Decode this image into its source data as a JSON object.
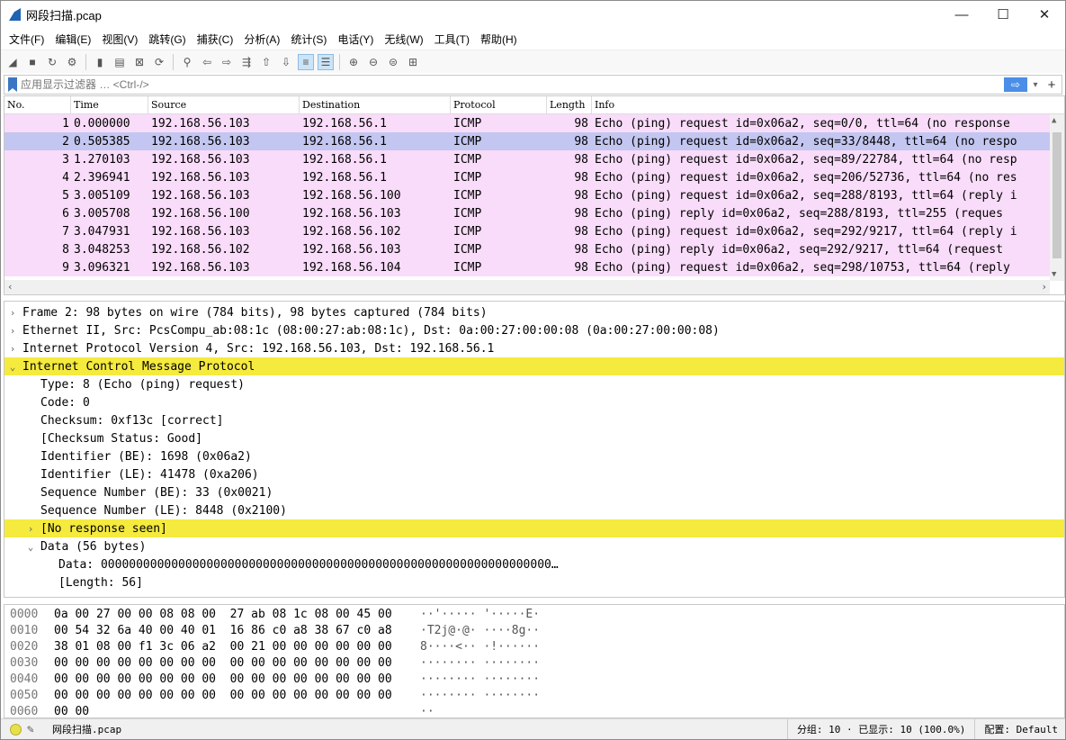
{
  "window": {
    "title": "网段扫描.pcap",
    "minimize": "—",
    "maximize": "☐",
    "close": "✕"
  },
  "menu": [
    "文件(F)",
    "编辑(E)",
    "视图(V)",
    "跳转(G)",
    "捕获(C)",
    "分析(A)",
    "统计(S)",
    "电话(Y)",
    "无线(W)",
    "工具(T)",
    "帮助(H)"
  ],
  "filter": {
    "placeholder": "应用显示过滤器 … <Ctrl-/>",
    "apply": "⇨",
    "dropdown": "▾",
    "add": "+"
  },
  "packet_list": {
    "columns": [
      "No.",
      "Time",
      "Source",
      "Destination",
      "Protocol",
      "Length",
      "Info"
    ],
    "rows": [
      {
        "no": "1",
        "time": "0.000000",
        "src": "192.168.56.103",
        "dst": "192.168.56.1",
        "proto": "ICMP",
        "len": "98",
        "info": "Echo (ping) request  id=0x06a2, seq=0/0, ttl=64 (no response"
      },
      {
        "no": "2",
        "time": "0.505385",
        "src": "192.168.56.103",
        "dst": "192.168.56.1",
        "proto": "ICMP",
        "len": "98",
        "info": "Echo (ping) request  id=0x06a2, seq=33/8448, ttl=64 (no respo"
      },
      {
        "no": "3",
        "time": "1.270103",
        "src": "192.168.56.103",
        "dst": "192.168.56.1",
        "proto": "ICMP",
        "len": "98",
        "info": "Echo (ping) request  id=0x06a2, seq=89/22784, ttl=64 (no resp"
      },
      {
        "no": "4",
        "time": "2.396941",
        "src": "192.168.56.103",
        "dst": "192.168.56.1",
        "proto": "ICMP",
        "len": "98",
        "info": "Echo (ping) request  id=0x06a2, seq=206/52736, ttl=64 (no res"
      },
      {
        "no": "5",
        "time": "3.005109",
        "src": "192.168.56.103",
        "dst": "192.168.56.100",
        "proto": "ICMP",
        "len": "98",
        "info": "Echo (ping) request  id=0x06a2, seq=288/8193, ttl=64 (reply i"
      },
      {
        "no": "6",
        "time": "3.005708",
        "src": "192.168.56.100",
        "dst": "192.168.56.103",
        "proto": "ICMP",
        "len": "98",
        "info": "Echo (ping) reply    id=0x06a2, seq=288/8193, ttl=255 (reques"
      },
      {
        "no": "7",
        "time": "3.047931",
        "src": "192.168.56.103",
        "dst": "192.168.56.102",
        "proto": "ICMP",
        "len": "98",
        "info": "Echo (ping) request  id=0x06a2, seq=292/9217, ttl=64 (reply i"
      },
      {
        "no": "8",
        "time": "3.048253",
        "src": "192.168.56.102",
        "dst": "192.168.56.103",
        "proto": "ICMP",
        "len": "98",
        "info": "Echo (ping) reply    id=0x06a2, seq=292/9217, ttl=64 (request"
      },
      {
        "no": "9",
        "time": "3.096321",
        "src": "192.168.56.103",
        "dst": "192.168.56.104",
        "proto": "ICMP",
        "len": "98",
        "info": "Echo (ping) request  id=0x06a2, seq=298/10753, ttl=64 (reply"
      }
    ]
  },
  "details": [
    {
      "indent": 0,
      "arrow": "›",
      "text": "Frame 2: 98 bytes on wire (784 bits), 98 bytes captured (784 bits)",
      "hl": false
    },
    {
      "indent": 0,
      "arrow": "›",
      "text": "Ethernet II, Src: PcsCompu_ab:08:1c (08:00:27:ab:08:1c), Dst: 0a:00:27:00:00:08 (0a:00:27:00:00:08)",
      "hl": false
    },
    {
      "indent": 0,
      "arrow": "›",
      "text": "Internet Protocol Version 4, Src: 192.168.56.103, Dst: 192.168.56.1",
      "hl": false
    },
    {
      "indent": 0,
      "arrow": "⌄",
      "text": "Internet Control Message Protocol",
      "hl": true
    },
    {
      "indent": 1,
      "arrow": "",
      "text": "Type: 8 (Echo (ping) request)",
      "hl": false
    },
    {
      "indent": 1,
      "arrow": "",
      "text": "Code: 0",
      "hl": false
    },
    {
      "indent": 1,
      "arrow": "",
      "text": "Checksum: 0xf13c [correct]",
      "hl": false
    },
    {
      "indent": 1,
      "arrow": "",
      "text": "[Checksum Status: Good]",
      "hl": false
    },
    {
      "indent": 1,
      "arrow": "",
      "text": "Identifier (BE): 1698 (0x06a2)",
      "hl": false
    },
    {
      "indent": 1,
      "arrow": "",
      "text": "Identifier (LE): 41478 (0xa206)",
      "hl": false
    },
    {
      "indent": 1,
      "arrow": "",
      "text": "Sequence Number (BE): 33 (0x0021)",
      "hl": false
    },
    {
      "indent": 1,
      "arrow": "",
      "text": "Sequence Number (LE): 8448 (0x2100)",
      "hl": false
    },
    {
      "indent": 1,
      "arrow": "›",
      "text": "[No response seen]",
      "hl": true
    },
    {
      "indent": 1,
      "arrow": "⌄",
      "text": "Data (56 bytes)",
      "hl": false
    },
    {
      "indent": 2,
      "arrow": "",
      "text": "Data: 0000000000000000000000000000000000000000000000000000000000000000…",
      "hl": false
    },
    {
      "indent": 2,
      "arrow": "",
      "text": "[Length: 56]",
      "hl": false
    }
  ],
  "bytes": [
    {
      "off": "0000",
      "hex": "0a 00 27 00 00 08 08 00  27 ab 08 1c 08 00 45 00",
      "asc": "··'····· '·····E·"
    },
    {
      "off": "0010",
      "hex": "00 54 32 6a 40 00 40 01  16 86 c0 a8 38 67 c0 a8",
      "asc": "·T2j@·@· ····8g··"
    },
    {
      "off": "0020",
      "hex": "38 01 08 00 f1 3c 06 a2  00 21 00 00 00 00 00 00",
      "asc": "8····<·· ·!······"
    },
    {
      "off": "0030",
      "hex": "00 00 00 00 00 00 00 00  00 00 00 00 00 00 00 00",
      "asc": "········ ········"
    },
    {
      "off": "0040",
      "hex": "00 00 00 00 00 00 00 00  00 00 00 00 00 00 00 00",
      "asc": "········ ········"
    },
    {
      "off": "0050",
      "hex": "00 00 00 00 00 00 00 00  00 00 00 00 00 00 00 00",
      "asc": "········ ········"
    },
    {
      "off": "0060",
      "hex": "00 00",
      "asc": "··"
    }
  ],
  "status": {
    "file": "网段扫描.pcap",
    "packets": "分组: 10 · 已显示: 10 (100.0%)",
    "profile": "配置: Default"
  }
}
